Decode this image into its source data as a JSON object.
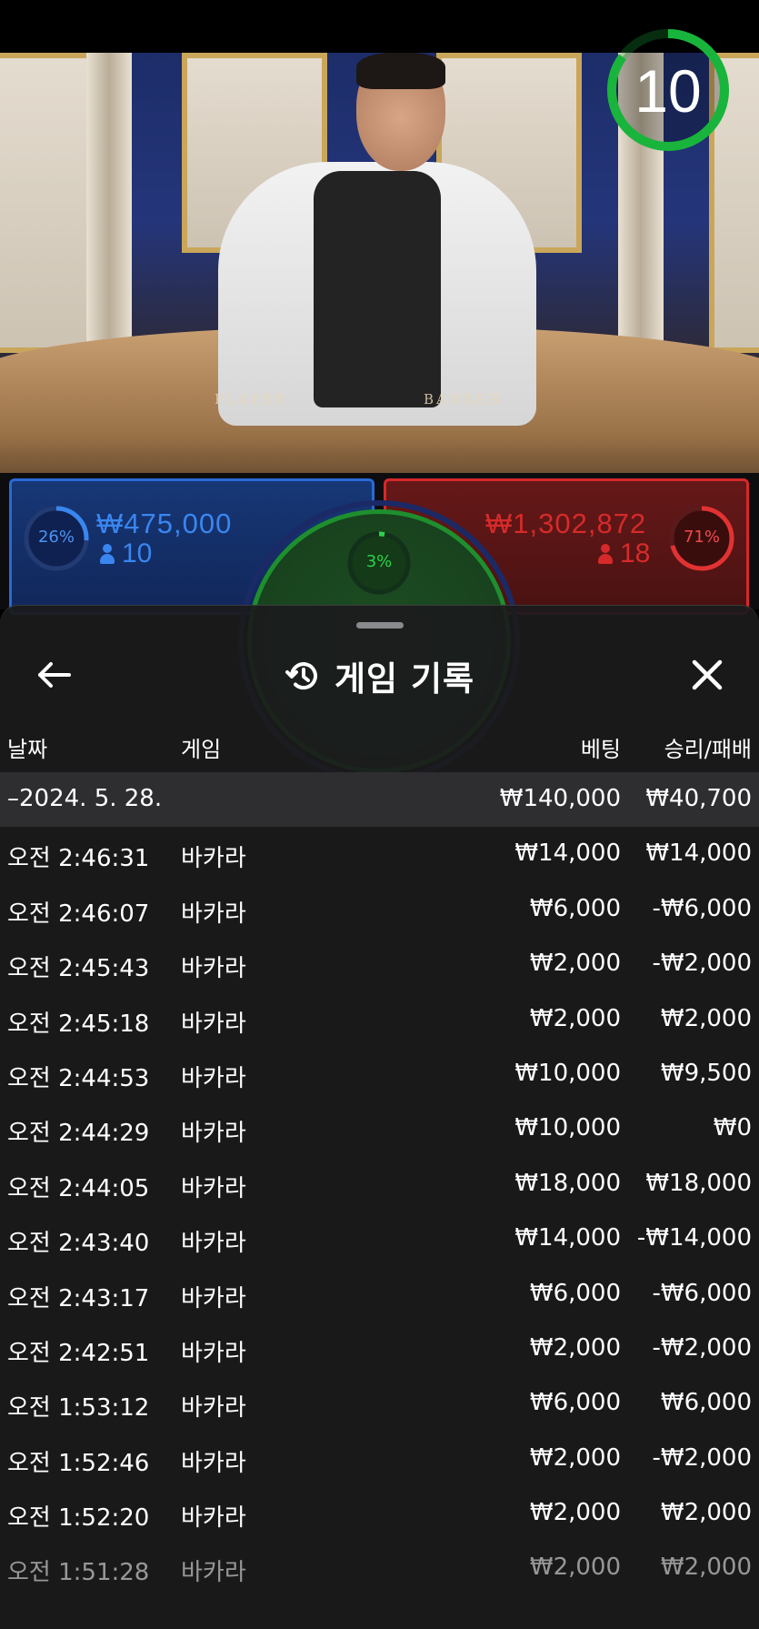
{
  "timer": {
    "seconds": "10",
    "progress": 0.85
  },
  "table": {
    "player_label": "PLAYER",
    "banker_label": "BANKER"
  },
  "bets": {
    "player": {
      "percent": "26%",
      "percent_value": 26,
      "amount": "₩475,000",
      "players": "10"
    },
    "tie": {
      "percent": "3%",
      "percent_value": 3
    },
    "banker": {
      "percent": "71%",
      "percent_value": 71,
      "amount": "₩1,302,872",
      "players": "18"
    }
  },
  "history": {
    "title": "게임 기록",
    "columns": {
      "date": "날짜",
      "game": "게임",
      "bet": "베팅",
      "result": "승리/패배"
    },
    "group": {
      "date": "–2024. 5. 28.",
      "bet": "₩140,000",
      "result": "₩40,700"
    },
    "rows": [
      {
        "time": "오전 2:46:31",
        "game": "바카라",
        "bet": "₩14,000",
        "result": "₩14,000"
      },
      {
        "time": "오전 2:46:07",
        "game": "바카라",
        "bet": "₩6,000",
        "result": "-₩6,000"
      },
      {
        "time": "오전 2:45:43",
        "game": "바카라",
        "bet": "₩2,000",
        "result": "-₩2,000"
      },
      {
        "time": "오전 2:45:18",
        "game": "바카라",
        "bet": "₩2,000",
        "result": "₩2,000"
      },
      {
        "time": "오전 2:44:53",
        "game": "바카라",
        "bet": "₩10,000",
        "result": "₩9,500"
      },
      {
        "time": "오전 2:44:29",
        "game": "바카라",
        "bet": "₩10,000",
        "result": "₩0"
      },
      {
        "time": "오전 2:44:05",
        "game": "바카라",
        "bet": "₩18,000",
        "result": "₩18,000"
      },
      {
        "time": "오전 2:43:40",
        "game": "바카라",
        "bet": "₩14,000",
        "result": "-₩14,000"
      },
      {
        "time": "오전 2:43:17",
        "game": "바카라",
        "bet": "₩6,000",
        "result": "-₩6,000"
      },
      {
        "time": "오전 2:42:51",
        "game": "바카라",
        "bet": "₩2,000",
        "result": "-₩2,000"
      },
      {
        "time": "오전 1:53:12",
        "game": "바카라",
        "bet": "₩6,000",
        "result": "₩6,000"
      },
      {
        "time": "오전 1:52:46",
        "game": "바카라",
        "bet": "₩2,000",
        "result": "-₩2,000"
      },
      {
        "time": "오전 1:52:20",
        "game": "바카라",
        "bet": "₩2,000",
        "result": "₩2,000"
      },
      {
        "time": "오전 1:51:28",
        "game": "바카라",
        "bet": "₩2,000",
        "result": "₩2,000"
      }
    ]
  },
  "colors": {
    "player": "#2a69d6",
    "banker": "#d6282a",
    "tie": "#1e8f2e",
    "timer": "#19b43c"
  }
}
